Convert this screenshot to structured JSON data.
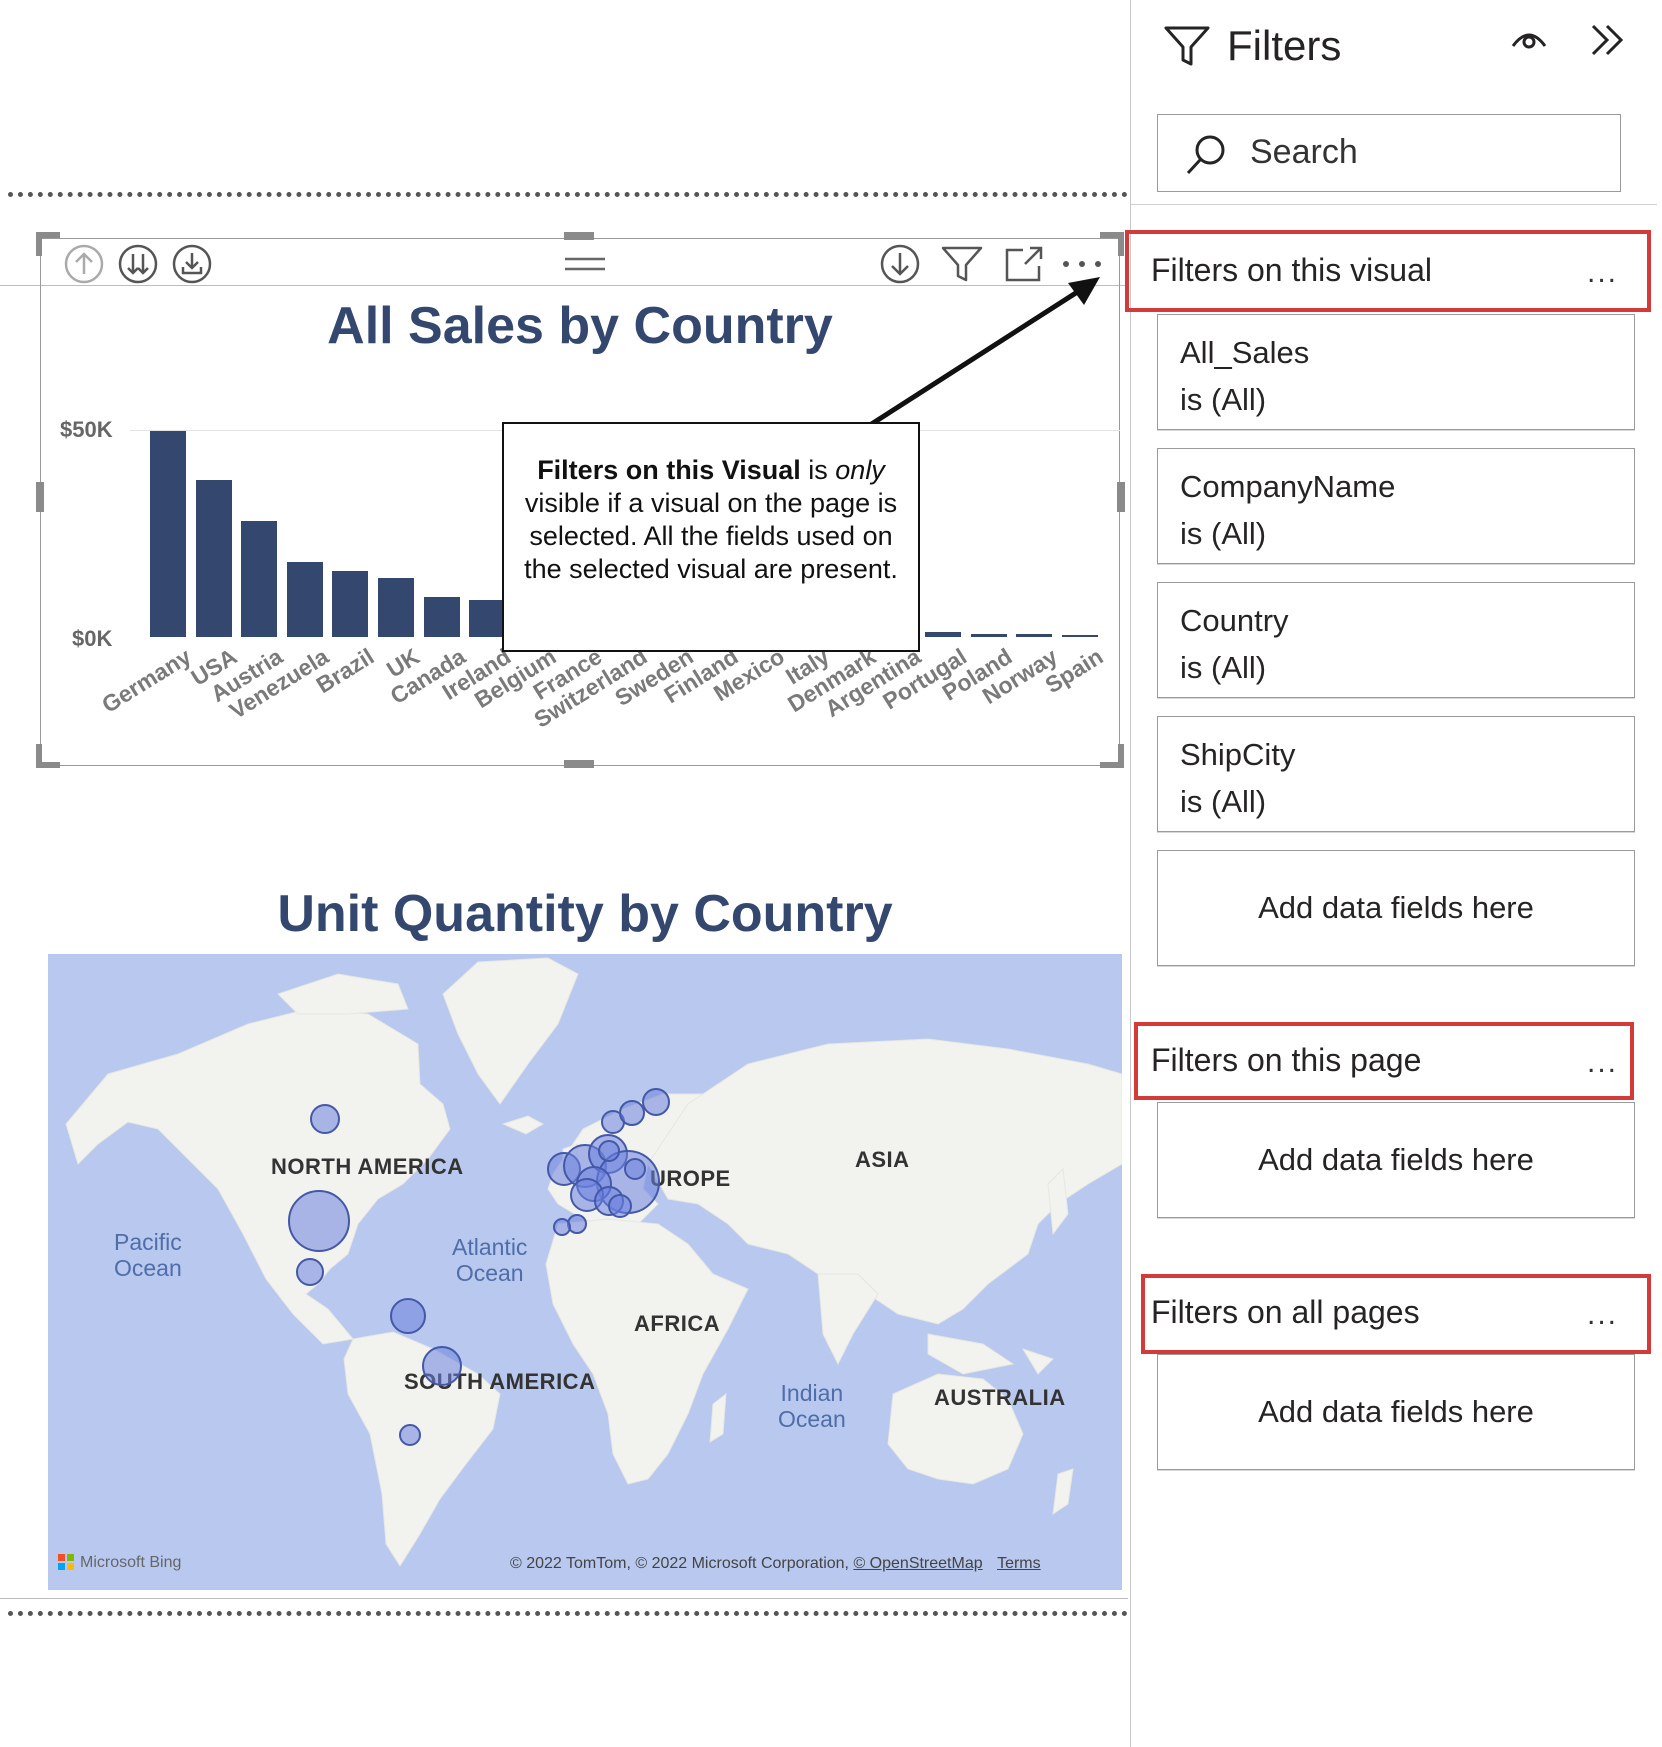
{
  "report": {
    "bar_visual": {
      "title": "All Sales by Country",
      "toolbar_icons": [
        "drill-up-icon",
        "expand-next-level-icon",
        "expand-all-icon",
        "drag-grip-icon",
        "drill-mode-icon",
        "filter-icon",
        "focus-mode-icon",
        "more-options-icon"
      ]
    },
    "map_visual": {
      "title": "Unit Quantity by Country",
      "continents": [
        "NORTH AMERICA",
        "SOUTH AMERICA",
        "UROPE",
        "ASIA",
        "AFRICA",
        "AUSTRALIA"
      ],
      "oceans": [
        {
          "line1": "Pacific",
          "line2": "Ocean"
        },
        {
          "line1": "Atlantic",
          "line2": "Ocean"
        },
        {
          "line1": "Indian",
          "line2": "Ocean"
        }
      ],
      "bing_logo": "Microsoft Bing",
      "copyright": "© 2022 TomTom, © 2022 Microsoft Corporation, ",
      "osm_link": "© OpenStreetMap",
      "terms_link": "Terms"
    },
    "callout": {
      "bold": "Filters on this Visual",
      "is": " is ",
      "only": "only",
      "rest": " visible if a visual on the page is selected. All the fields used on the selected visual are present."
    }
  },
  "chart_data": {
    "type": "bar",
    "title": "All Sales by Country",
    "categories": [
      "Germany",
      "USA",
      "Austria",
      "Venezuela",
      "Brazil",
      "UK",
      "Canada",
      "Ireland",
      "Belgium",
      "France",
      "Switzerland",
      "Sweden",
      "Finland",
      "Mexico",
      "Italy",
      "Denmark",
      "Argentina",
      "Portugal",
      "Poland",
      "Norway",
      "Spain"
    ],
    "values": [
      50000,
      38000,
      28000,
      18000,
      16000,
      14300,
      9600,
      9000,
      8500,
      8000,
      7000,
      6000,
      5000,
      4000,
      3000,
      2500,
      1500,
      1200,
      800,
      700,
      500
    ],
    "y_ticks": [
      "$50K",
      "$0K"
    ],
    "ylim": [
      0,
      50000
    ],
    "grid": true
  },
  "filters_pane": {
    "title": "Filters",
    "search_placeholder": "Search",
    "sections": {
      "visual": {
        "label": "Filters on this visual",
        "more": "...",
        "cards": [
          {
            "field": "All_Sales",
            "condition": "is (All)"
          },
          {
            "field": "CompanyName",
            "condition": "is (All)"
          },
          {
            "field": "Country",
            "condition": "is (All)"
          },
          {
            "field": "ShipCity",
            "condition": "is (All)"
          }
        ],
        "add_label": "Add data fields here"
      },
      "page": {
        "label": "Filters on this page",
        "more": "...",
        "add_label": "Add data fields here"
      },
      "all": {
        "label": "Filters on all pages",
        "more": "...",
        "add_label": "Add data fields here"
      }
    }
  }
}
